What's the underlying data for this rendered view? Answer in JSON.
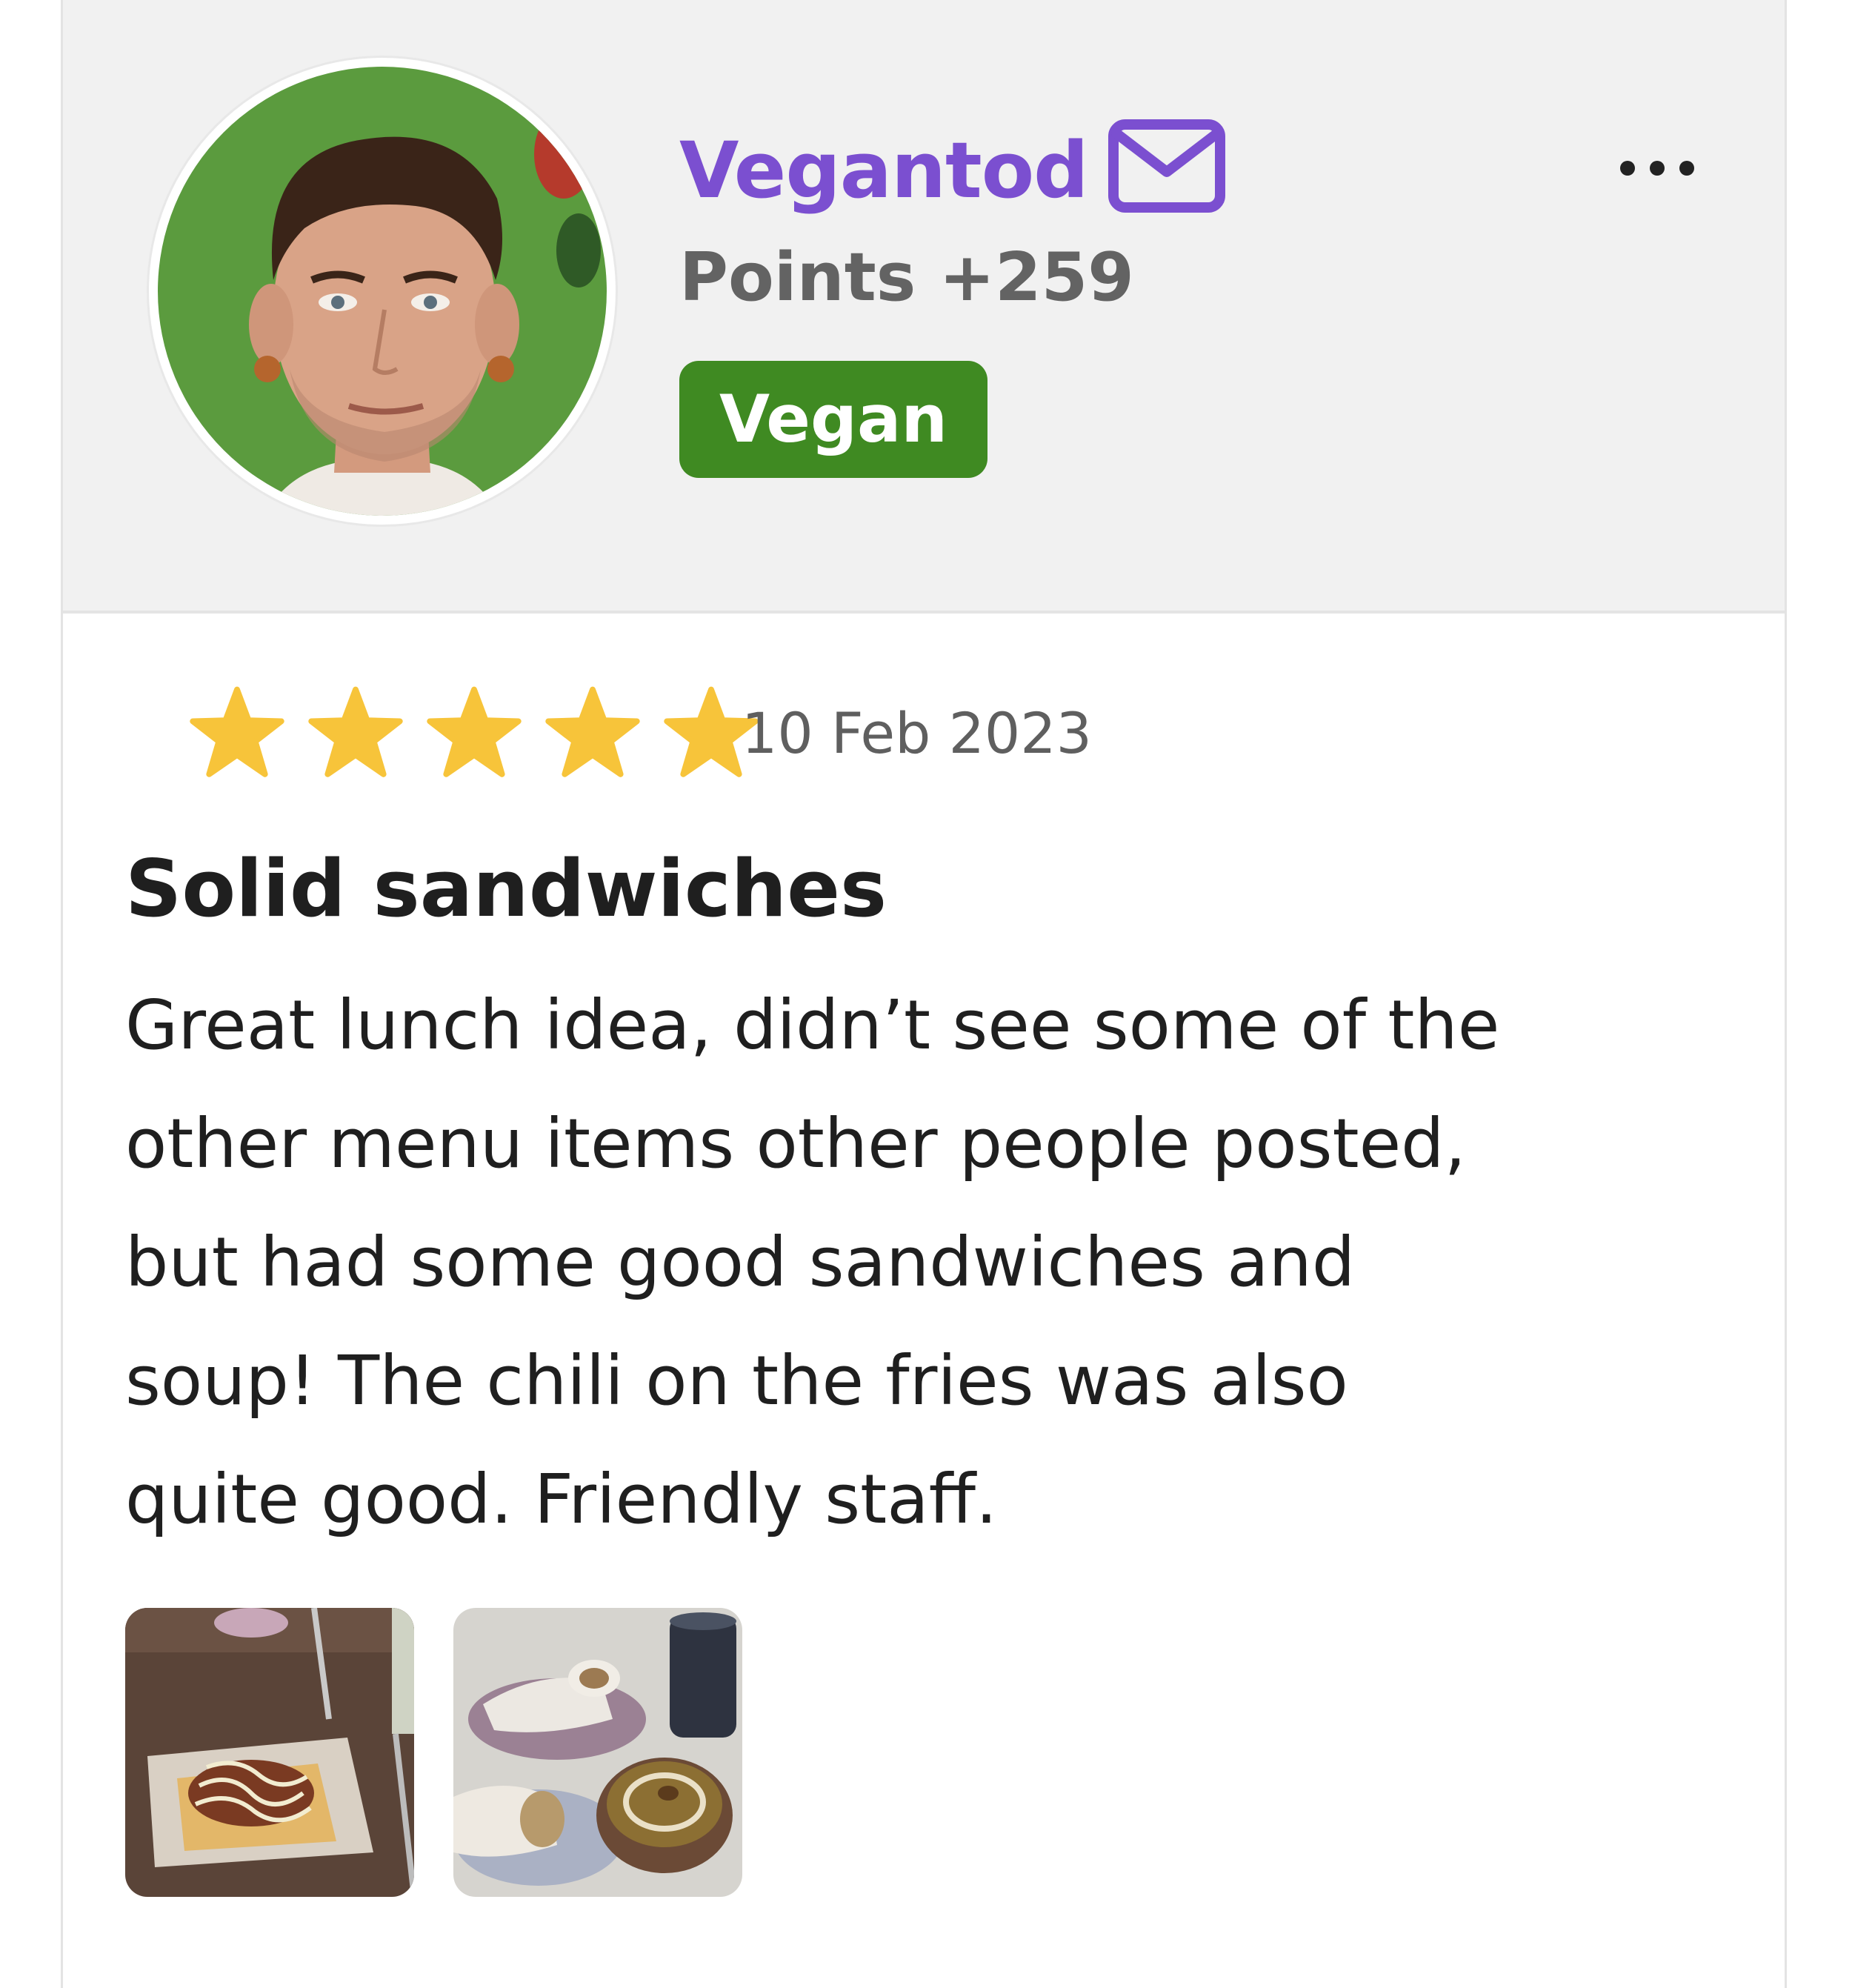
{
  "user": {
    "name": "Vegantod",
    "points": "Points +259",
    "badge": "Vegan",
    "mail_icon": "envelope-icon",
    "avatar": "user-avatar-photo"
  },
  "menu": {
    "icon": "more-horizontal-icon"
  },
  "review": {
    "rating": 5,
    "rating_max": 5,
    "date": "10 Feb 2023",
    "title": "Solid sandwiches",
    "body_lines": [
      "Great lunch idea, didn’t see some of the",
      "other menu items other people posted,",
      "but had some good sandwiches and",
      "soup! The chili on the fries was also",
      "quite good. Friendly staff."
    ],
    "photos": [
      "chili-fries-photo",
      "wraps-and-soup-photo"
    ]
  },
  "colors": {
    "username": "#7b4fd0",
    "badge": "#3f8a22",
    "star": "#f7c43a",
    "header_bg": "#f1f1f1"
  }
}
